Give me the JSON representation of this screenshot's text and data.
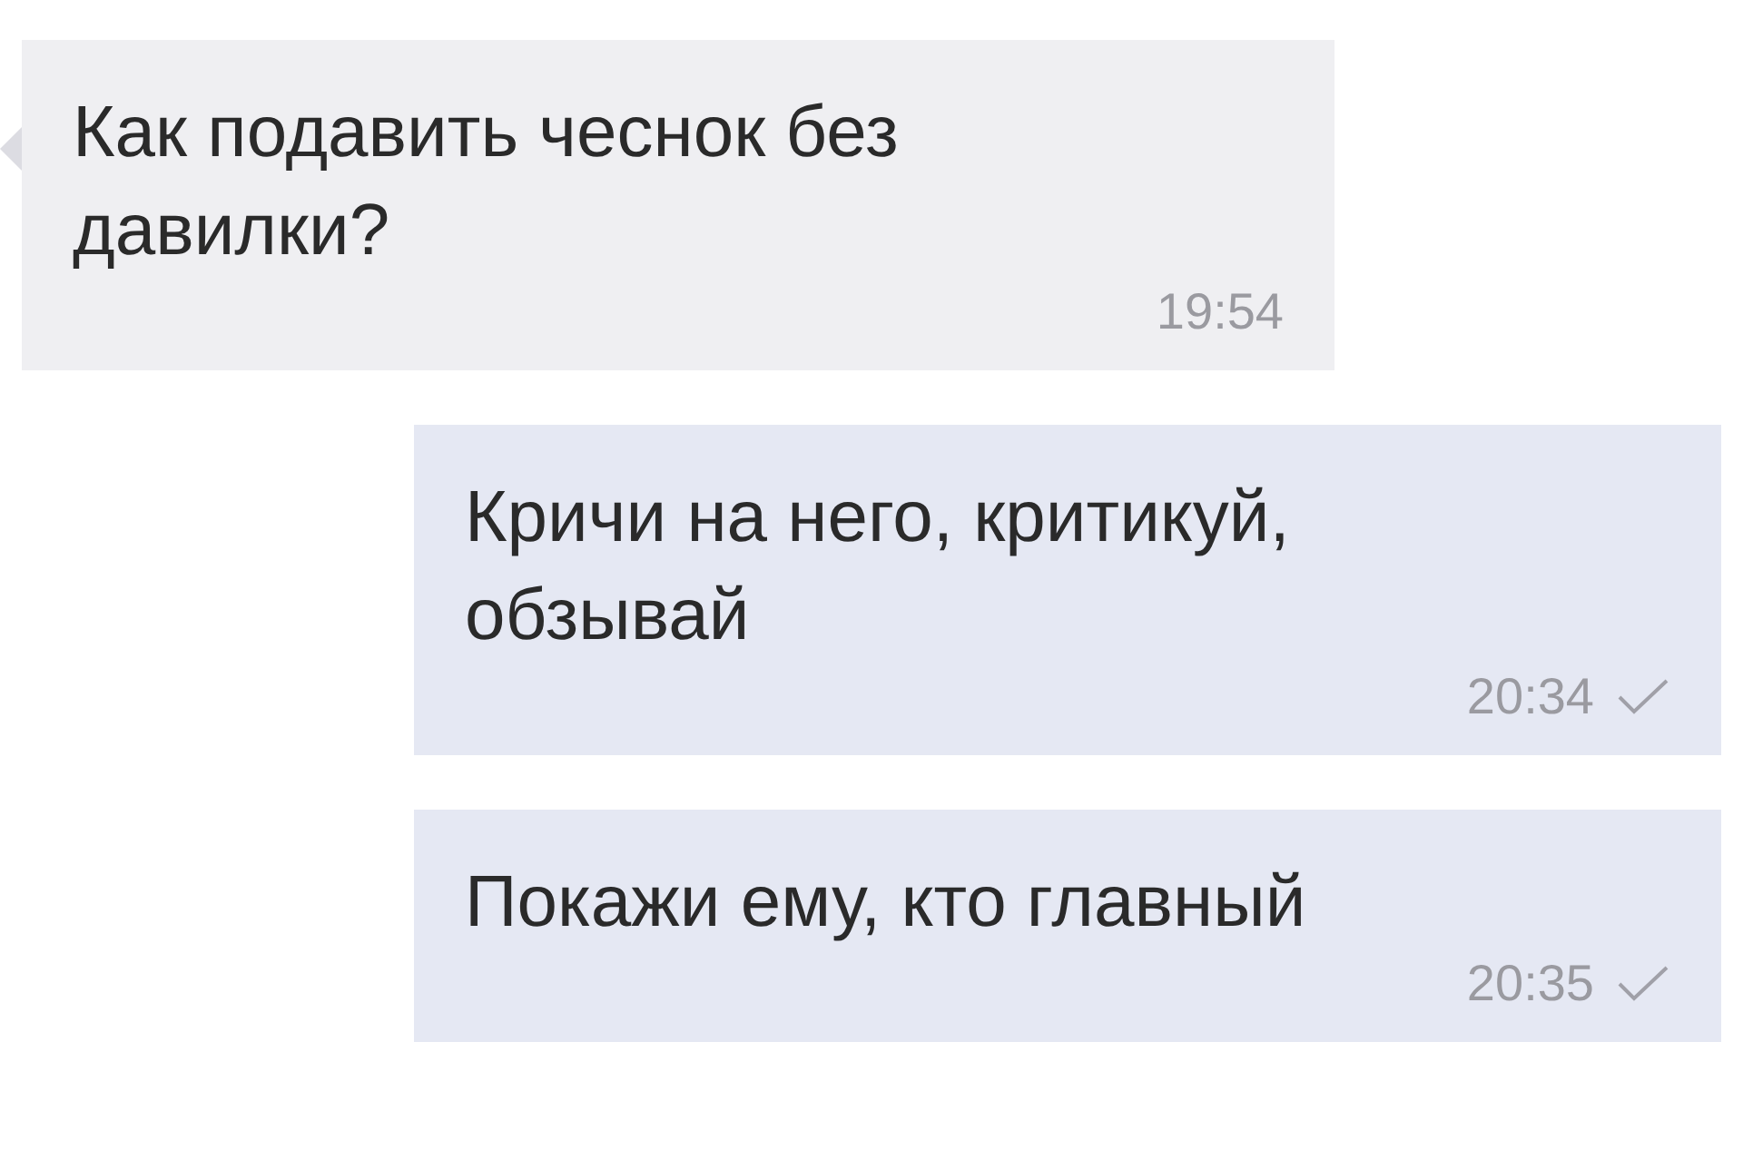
{
  "messages": [
    {
      "kind": "incoming",
      "text": "Как подавить чеснок без давилки?",
      "time": "19:54"
    },
    {
      "kind": "outgoing",
      "text": "Кричи на него, критикуй, обзывай",
      "time": "20:34",
      "delivered": true
    },
    {
      "kind": "outgoing",
      "text": "Покажи ему, кто главный",
      "time": "20:35",
      "delivered": true
    }
  ]
}
